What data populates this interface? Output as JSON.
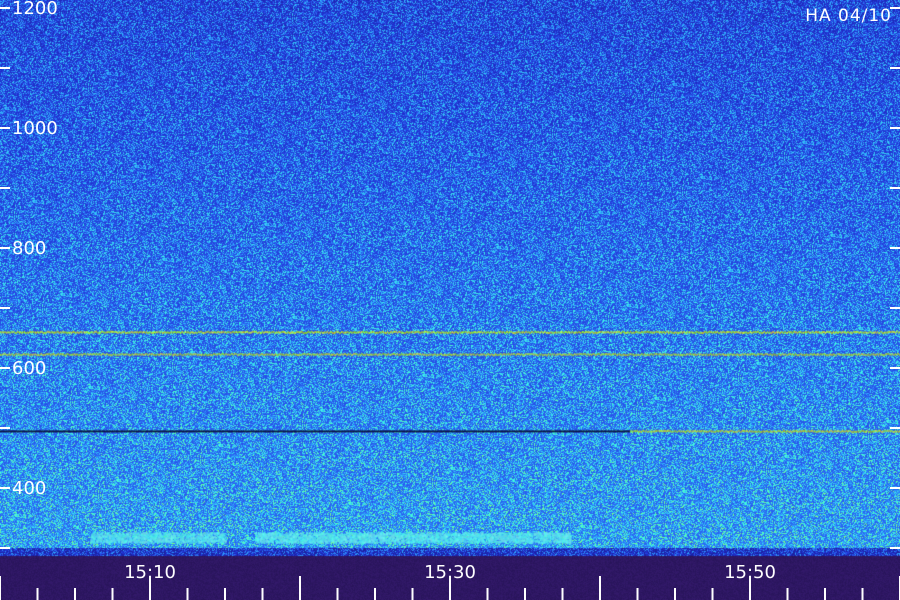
{
  "station_label": "HA 04/10",
  "chart_data": {
    "type": "heatmap",
    "title": "",
    "xlabel": "",
    "ylabel": "",
    "x_axis": {
      "type": "time",
      "start": "15:00",
      "end": "16:00",
      "major_ticks": [
        "15:10",
        "15:30",
        "15:50"
      ],
      "minor_tick_interval_minutes": 2.5
    },
    "y_axis": {
      "units": "Hz",
      "range": [
        300,
        1200
      ],
      "ticks": [
        1200,
        1000,
        800,
        600,
        400
      ],
      "minor_ticks": [
        1100,
        900,
        700,
        500,
        300
      ]
    },
    "colormap": [
      "#1a1a8c",
      "#2030d0",
      "#2a60f0",
      "#30b0ff",
      "#40ffe0",
      "#a0ff40"
    ],
    "emission_lines": [
      {
        "freq_hz": 661,
        "intensity": 1.0,
        "start": "15:00",
        "end": "16:00"
      },
      {
        "freq_hz": 624,
        "intensity": 0.75,
        "start": "15:00",
        "end": "16:00"
      },
      {
        "freq_hz": 496,
        "intensity": 0.85,
        "start": "15:42",
        "end": "16:00"
      }
    ],
    "absorption_lines": [
      {
        "freq_hz": 496,
        "start": "15:00",
        "end": "15:42"
      }
    ],
    "bursts": [
      {
        "freq_hz": 320,
        "start": "15:17",
        "end": "15:38",
        "intensity": 0.8
      },
      {
        "freq_hz": 320,
        "start": "15:06",
        "end": "15:15",
        "intensity": 0.5
      }
    ],
    "grid": false,
    "legend": "none"
  }
}
